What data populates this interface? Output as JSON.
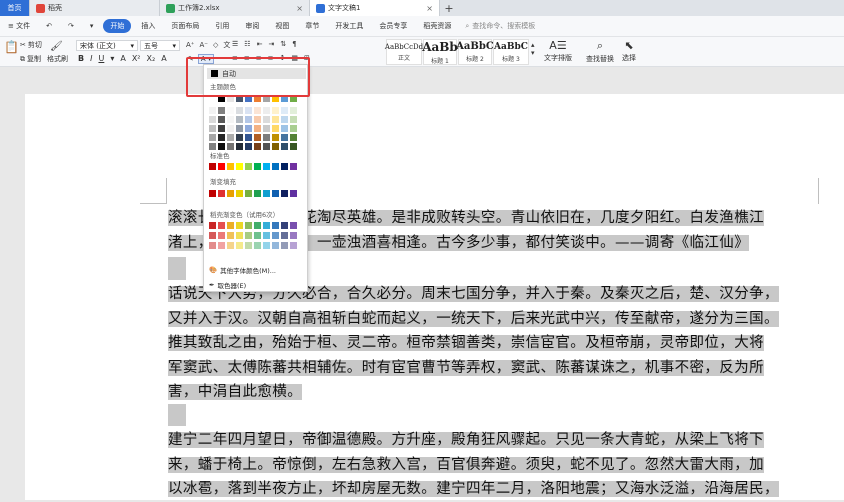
{
  "tabs": {
    "home": "首页",
    "t1": "稻壳",
    "t2": "工作簿2.xlsx",
    "t3": "文字文稿1",
    "new_tab": "+"
  },
  "menu": {
    "file": "≡ 文件",
    "items": [
      "开始",
      "插入",
      "页面布局",
      "引用",
      "审阅",
      "视图",
      "章节",
      "开发工具",
      "会员专享",
      "稻壳资源"
    ],
    "search": "查找命令、搜索模板"
  },
  "toolbar": {
    "cut": "剪切",
    "copy": "复制",
    "format_painter": "格式刷",
    "paste": "粘贴",
    "font_name": "宋体 (正文)",
    "font_size": "五号",
    "styles": [
      {
        "sample": "AaBbCcDd",
        "label": "正文"
      },
      {
        "sample": "AaBb",
        "label": "标题 1"
      },
      {
        "sample": "AaBbC",
        "label": "标题 2"
      },
      {
        "sample": "AaBbC",
        "label": "标题 3"
      }
    ],
    "text_layout": "文字排版",
    "find_replace": "查找替换",
    "select": "选择"
  },
  "color_popup": {
    "auto": "自动",
    "theme_colors": "主题颜色",
    "standard_colors": "标准色",
    "gradient_fill": "渐变填充",
    "shell_gradient": "稻壳渐变色（试用6次）",
    "more_colors": "其他字体颜色(M)...",
    "eyedropper": "取色器(E)",
    "colors": {
      "theme_top": [
        "#ffffff",
        "#000000",
        "#e7e6e6",
        "#44546a",
        "#4472c4",
        "#ed7d31",
        "#a5a5a5",
        "#ffc000",
        "#5b9bd5",
        "#70ad47"
      ],
      "standard": [
        "#c00000",
        "#ff0000",
        "#ffc000",
        "#ffff00",
        "#92d050",
        "#00b050",
        "#00b0f0",
        "#0070c0",
        "#002060",
        "#7030a0"
      ],
      "gradient": [
        "#c00000",
        "#e03030",
        "#e8a000",
        "#e8d000",
        "#78b040",
        "#20a050",
        "#10a0d0",
        "#1060b0",
        "#102060",
        "#6030a0"
      ]
    }
  },
  "document": {
    "para1_line1": "滚滚长江东逝水，浪花淘尽英雄。是非成败转头空。青山依旧在，几度夕阳红。白发渔樵江",
    "para1_line2": "渚上，惯看秋月春风。一壶浊酒喜相逢。古今多少事，都付笑谈中。——调寄《临江仙》",
    "para2_line1": "话说天下大势，分久必合，合久必分。周末七国分争，并入于秦。及秦灭之后，楚、汉分争，",
    "para2_line2": "又并入于汉。汉朝自高祖斩白蛇而起义，一统天下，后来光武中兴，传至献帝，遂分为三国。",
    "para2_line3": "推其致乱之由，殆始于桓、灵二帝。桓帝禁锢善类，崇信宦官。及桓帝崩，灵帝即位，大将",
    "para2_line4": "军窦武、太傅陈蕃共相辅佐。时有宦官曹节等弄权，窦武、陈蕃谋诛之，机事不密，反为所",
    "para2_line5": "害，中涓自此愈横。",
    "para3_line1": "建宁二年四月望日，帝御温德殿。方升座，殿角狂风骤起。只见一条大青蛇，从梁上飞将下",
    "para3_line2": "来，蟠于椅上。帝惊倒，左右急救入宫，百官俱奔避。须臾，蛇不见了。忽然大雷大雨，加",
    "para3_line3": "以冰雹，落到半夜方止，坏却房屋无数。建宁四年二月，洛阳地震；又海水泛溢，沿海居民，"
  }
}
